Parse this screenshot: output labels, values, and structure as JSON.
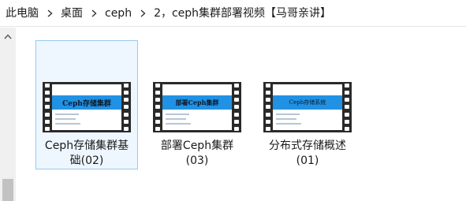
{
  "breadcrumb": {
    "items": [
      "此电脑",
      "桌面",
      "ceph",
      "2，ceph集群部署视频【马哥亲讲】"
    ]
  },
  "files": [
    {
      "name": "Ceph存储集群基础(02)",
      "line1": "Ceph存储集群基",
      "line2": "础(02)",
      "thumb_title": "Ceph存储集群",
      "selected": true
    },
    {
      "name": "部署Ceph集群(03)",
      "line1": "部署Ceph集群",
      "line2": "(03)",
      "thumb_title": "部署Ceph集群",
      "selected": false
    },
    {
      "name": "分布式存储概述(01)",
      "line1": "分布式存储概述",
      "line2": "(01)",
      "thumb_title": "Ceph存储系统",
      "selected": false
    }
  ],
  "colors": {
    "thumb_band": "#2191e3",
    "film": "#2a2a2a",
    "selection_bg": "#eef6ff",
    "selection_border": "#99c9ef"
  },
  "icons": {
    "separator": "chevron-right-icon",
    "scroll_up": "chevron-up-icon"
  }
}
